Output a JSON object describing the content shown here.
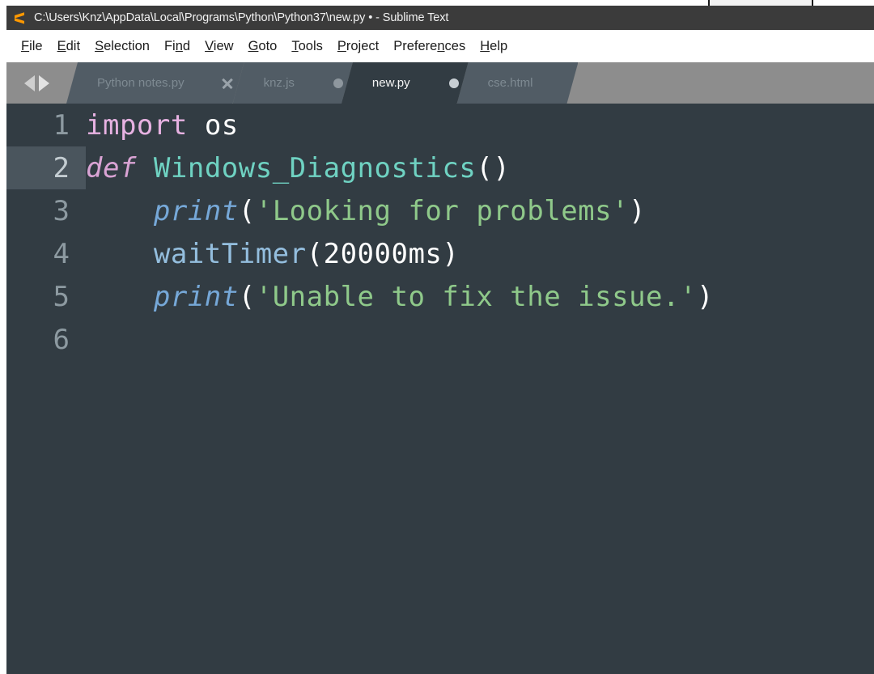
{
  "window": {
    "title": "C:\\Users\\Knz\\AppData\\Local\\Programs\\Python\\Python37\\new.py • - Sublime Text",
    "app_icon": "sublime-text-logo-icon"
  },
  "menubar": {
    "items": [
      {
        "label": "File",
        "pre": "",
        "acc": "F",
        "post": "ile"
      },
      {
        "label": "Edit",
        "pre": "",
        "acc": "E",
        "post": "dit"
      },
      {
        "label": "Selection",
        "pre": "",
        "acc": "S",
        "post": "election"
      },
      {
        "label": "Find",
        "pre": "Fi",
        "acc": "n",
        "post": "d"
      },
      {
        "label": "View",
        "pre": "",
        "acc": "V",
        "post": "iew"
      },
      {
        "label": "Goto",
        "pre": "",
        "acc": "G",
        "post": "oto"
      },
      {
        "label": "Tools",
        "pre": "",
        "acc": "T",
        "post": "ools"
      },
      {
        "label": "Project",
        "pre": "",
        "acc": "P",
        "post": "roject"
      },
      {
        "label": "Preferences",
        "pre": "Prefere",
        "acc": "n",
        "post": "ces"
      },
      {
        "label": "Help",
        "pre": "",
        "acc": "H",
        "post": "elp"
      }
    ]
  },
  "tabbar": {
    "nav_prev_icon": "chevron-left-icon",
    "nav_next_icon": "chevron-right-icon",
    "tabs": [
      {
        "label": "Python notes.py",
        "active": false,
        "indicator": "close"
      },
      {
        "label": "knz.js",
        "active": false,
        "indicator": "dirty"
      },
      {
        "label": "new.py",
        "active": true,
        "indicator": "dirty"
      },
      {
        "label": "cse.html",
        "active": false,
        "indicator": "none"
      }
    ]
  },
  "editor": {
    "current_line": 2,
    "lines": [
      {
        "number": "1",
        "tokens": [
          {
            "text": "import",
            "type": "import"
          },
          {
            "text": " ",
            "type": "plain"
          },
          {
            "text": "os",
            "type": "plain"
          }
        ]
      },
      {
        "number": "2",
        "tokens": [
          {
            "text": "def",
            "type": "keyword"
          },
          {
            "text": " ",
            "type": "plain"
          },
          {
            "text": "Windows_Diagnostics",
            "type": "func"
          },
          {
            "text": "()",
            "type": "punct"
          }
        ]
      },
      {
        "number": "3",
        "tokens": [
          {
            "text": "    ",
            "type": "plain"
          },
          {
            "text": "print",
            "type": "builtin"
          },
          {
            "text": "(",
            "type": "punct"
          },
          {
            "text": "'Looking for problems'",
            "type": "string"
          },
          {
            "text": ")",
            "type": "punct"
          }
        ]
      },
      {
        "number": "4",
        "tokens": [
          {
            "text": "    ",
            "type": "plain"
          },
          {
            "text": "waitTimer",
            "type": "call"
          },
          {
            "text": "(",
            "type": "punct"
          },
          {
            "text": "20000ms",
            "type": "plain"
          },
          {
            "text": ")",
            "type": "punct"
          }
        ]
      },
      {
        "number": "5",
        "tokens": [
          {
            "text": "    ",
            "type": "plain"
          },
          {
            "text": "print",
            "type": "builtin"
          },
          {
            "text": "(",
            "type": "punct"
          },
          {
            "text": "'Unable to fix the issue.'",
            "type": "string"
          },
          {
            "text": ")",
            "type": "punct"
          }
        ]
      },
      {
        "number": "6",
        "tokens": []
      }
    ]
  },
  "colors": {
    "titlebar_bg": "#3b3b3b",
    "menubar_bg": "#ffffff",
    "tabbar_bg": "#8d8d8d",
    "tab_inactive_bg": "#515c65",
    "tab_active_bg": "#323c43",
    "editor_bg": "#323c43",
    "gutter_text": "#8d9aa1",
    "current_line_bg": "#4a555d",
    "keyword": "#d9a3d4",
    "function": "#6fd2c2",
    "builtin": "#76a8d8",
    "string": "#8fc98a",
    "plain": "#ffffff",
    "logo_orange": "#ff9800"
  }
}
